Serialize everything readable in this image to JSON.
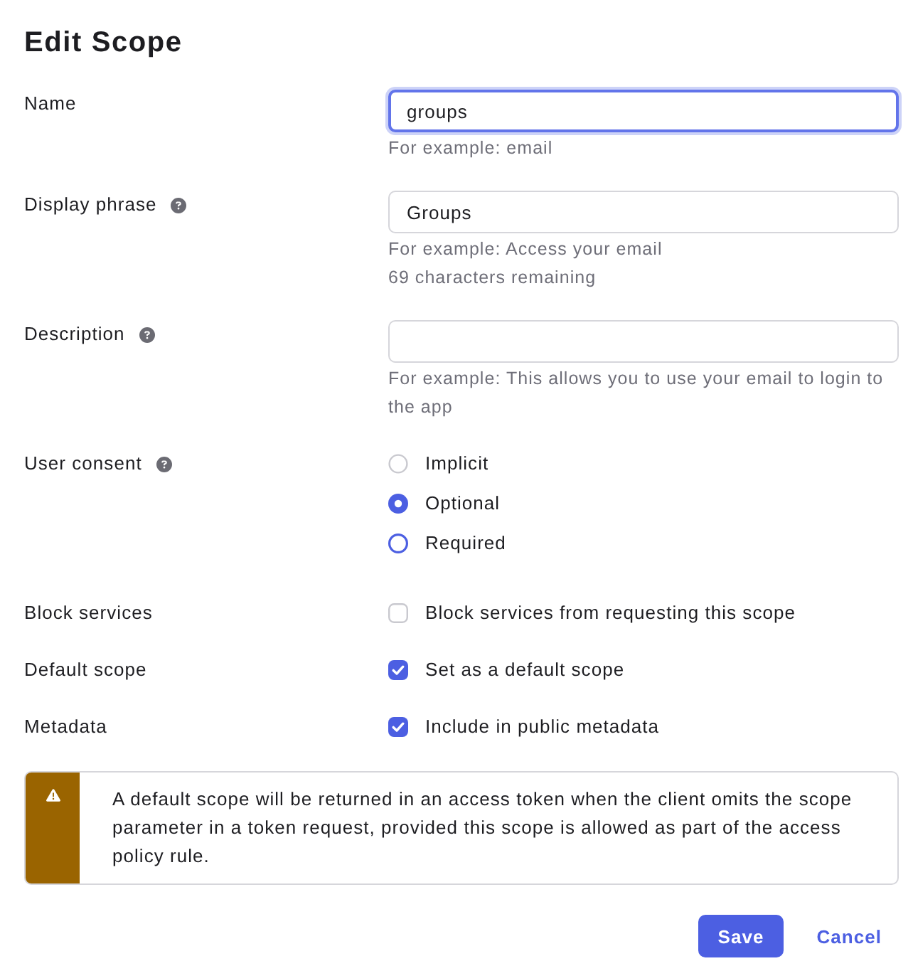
{
  "title": "Edit Scope",
  "fields": [
    {
      "kind": "text",
      "label": "Name",
      "help": false,
      "value": "groups",
      "focused": true,
      "hints": [
        "For example: email"
      ]
    },
    {
      "kind": "text",
      "label": "Display phrase",
      "help": true,
      "value": "Groups",
      "focused": false,
      "hints": [
        "For example: Access your email",
        "69 characters remaining"
      ]
    },
    {
      "kind": "text",
      "label": "Description",
      "help": true,
      "focused": false,
      "hints": [
        "For example: This allows you to use your email to login to the app"
      ]
    },
    {
      "kind": "radio",
      "label": "User consent",
      "help": true,
      "options": [
        {
          "label": "Implicit",
          "selected": false,
          "focused": false
        },
        {
          "label": "Optional",
          "selected": true,
          "focused": false
        },
        {
          "label": "Required",
          "selected": false,
          "focused": true
        }
      ]
    },
    {
      "kind": "checkbox",
      "label": "Block services",
      "help": false,
      "option": "Block services from requesting this scope",
      "checked": false
    },
    {
      "kind": "checkbox",
      "label": "Default scope",
      "help": false,
      "option": "Set as a default scope",
      "checked": true
    },
    {
      "kind": "checkbox",
      "label": "Metadata",
      "help": false,
      "option": "Include in public metadata",
      "checked": true
    }
  ],
  "callout": {
    "kind": "warning",
    "text": "A default scope will be returned in an access token when the client omits the scope parameter in a token request, provided this scope is allowed as part of the access policy rule."
  },
  "buttons": [
    {
      "kind": "primary",
      "label": "Save"
    },
    {
      "kind": "link",
      "label": "Cancel"
    }
  ]
}
